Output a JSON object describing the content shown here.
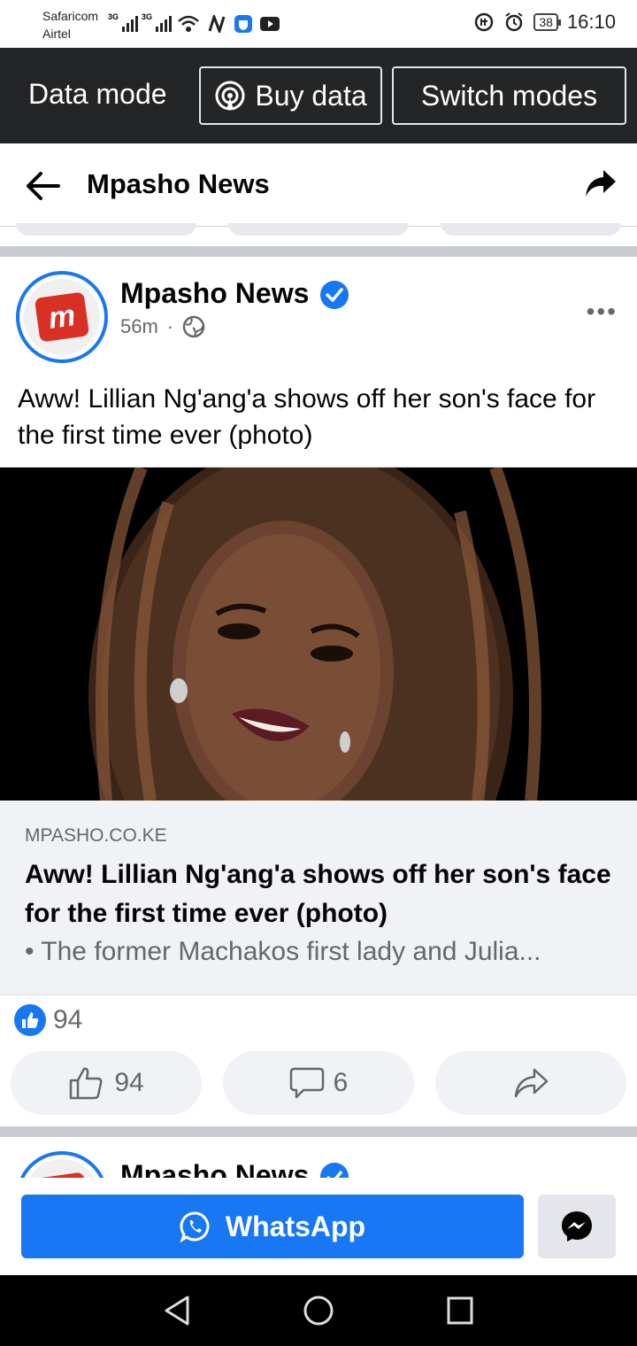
{
  "status_bar": {
    "carrier1": "Safaricom",
    "carrier2": "Airtel",
    "net1": "3G",
    "net2": "3G",
    "battery": "38",
    "time": "16:10"
  },
  "data_bar": {
    "mode_label": "Data mode",
    "buy_label": "Buy data",
    "switch_label": "Switch modes"
  },
  "header": {
    "title": "Mpasho News"
  },
  "post": {
    "page_name": "Mpasho News",
    "avatar_letter": "m",
    "time": "56m",
    "separator": "·",
    "menu": "•••",
    "text": "Aww! Lillian Ng'ang'a shows off her son's face for the first time ever (photo)",
    "link": {
      "domain": "MPASHO.CO.KE",
      "title": "Aww! Lillian Ng'ang'a shows off her son's face for the first time ever (photo)",
      "description": "• The former Machakos first lady and Julia..."
    },
    "reaction_count": "94",
    "like_count": "94",
    "comment_count": "6"
  },
  "next_post": {
    "page_name": "Mpasho News"
  },
  "bottom": {
    "whatsapp_label": "WhatsApp"
  },
  "colors": {
    "accent": "#1877f2",
    "dark_bar": "#242526",
    "muted": "#65676b"
  }
}
